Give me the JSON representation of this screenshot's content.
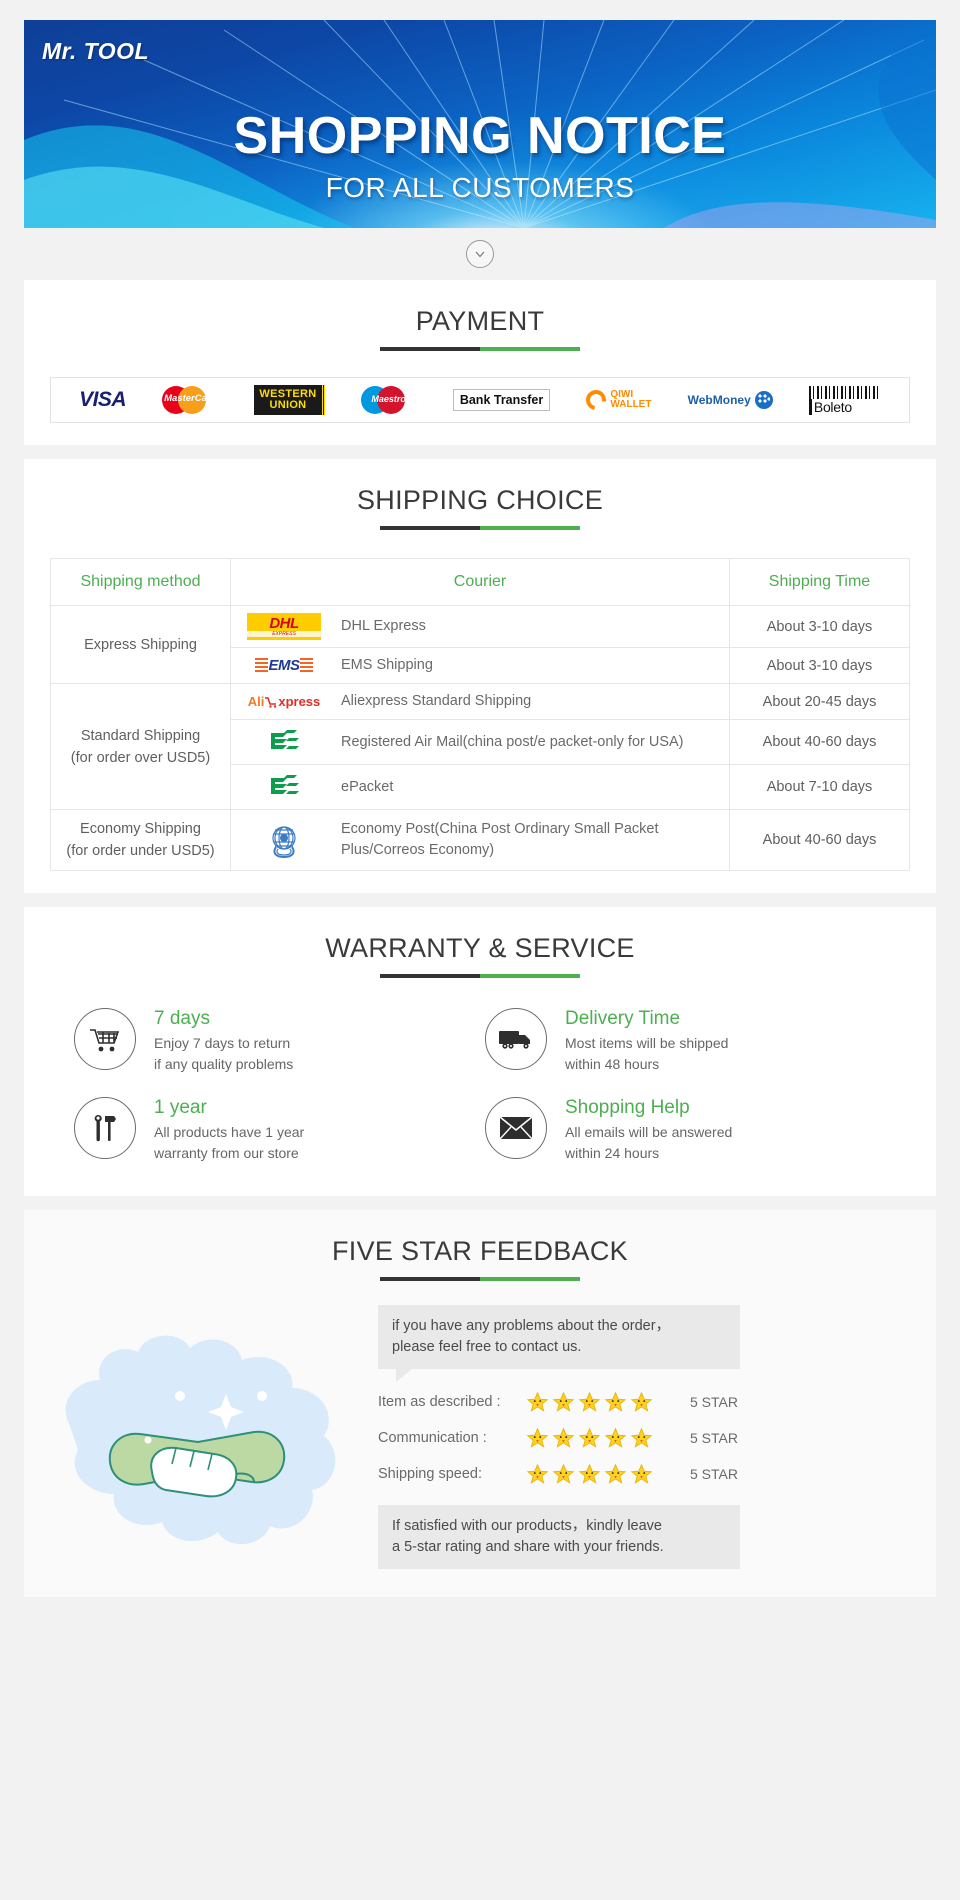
{
  "banner": {
    "logo": "Mr. TOOL",
    "title": "SHOPPING NOTICE",
    "subtitle": "FOR ALL CUSTOMERS",
    "scroll_icon": "chevron-down-icon"
  },
  "payment": {
    "heading": "PAYMENT",
    "methods": [
      {
        "name": "VISA",
        "icon": "visa-logo"
      },
      {
        "name": "MasterCard",
        "icon": "mastercard-logo"
      },
      {
        "name": "WESTERN UNION",
        "line1": "WESTERN",
        "line2": "UNION",
        "icon": "western-union-logo"
      },
      {
        "name": "Maestro",
        "icon": "maestro-logo"
      },
      {
        "name": "Bank Transfer",
        "icon": "bank-transfer-logo"
      },
      {
        "name": "QIWI WALLET",
        "line1": "QIWI",
        "line2": "WALLET",
        "icon": "qiwi-wallet-logo"
      },
      {
        "name": "WebMoney",
        "icon": "webmoney-logo"
      },
      {
        "name": "Boletо",
        "icon": "boleto-logo"
      }
    ]
  },
  "shipping": {
    "heading": "SHIPPING CHOICE",
    "columns": [
      "Shipping method",
      "Courier",
      "Shipping Time"
    ],
    "groups": [
      {
        "method": "Express Shipping",
        "rows": [
          {
            "logo": "dhl-logo",
            "courier": "DHL Express",
            "time": "About 3-10 days"
          },
          {
            "logo": "ems-logo",
            "courier": "EMS Shipping",
            "time": "About 3-10 days"
          }
        ]
      },
      {
        "method": "Standard Shipping\n(for order over USD5)",
        "method_line1": "Standard Shipping",
        "method_line2": "(for order over USD5)",
        "rows": [
          {
            "logo": "aliexpress-logo",
            "courier": "Aliexpress Standard Shipping",
            "time": "About 20-45 days"
          },
          {
            "logo": "china-post-logo",
            "courier": "Registered Air Mail(china post/e packet-only for USA)",
            "time": "About 40-60 days"
          },
          {
            "logo": "china-post-logo",
            "courier": "ePacket",
            "time": "About 7-10 days"
          }
        ]
      },
      {
        "method_line1": "Economy Shipping",
        "method_line2": "(for order under USD5)",
        "rows": [
          {
            "logo": "un-logo",
            "courier": "Economy Post(China Post Ordinary Small Packet Plus/Correos Economy)",
            "time": "About 40-60 days"
          }
        ]
      }
    ]
  },
  "warranty": {
    "heading": "WARRANTY & SERVICE",
    "features": [
      {
        "icon": "shopping-cart-icon",
        "title": "7 days",
        "line1": "Enjoy 7 days to return",
        "line2": "if any quality problems"
      },
      {
        "icon": "truck-icon",
        "title": "Delivery Time",
        "line1": "Most items will be shipped",
        "line2": "within 48 hours"
      },
      {
        "icon": "tools-icon",
        "title": "1 year",
        "line1": "All products have 1 year",
        "line2": "warranty from our store"
      },
      {
        "icon": "envelope-icon",
        "title": "Shopping Help",
        "line1": "All emails will be answered",
        "line2": "within 24 hours"
      }
    ]
  },
  "feedback": {
    "heading": "FIVE STAR FEEDBACK",
    "illustration": "handshake-illustration",
    "top_bubble_line1": "if you have any problems about the order，",
    "top_bubble_line2": "please feel free to contact us.",
    "ratings": [
      {
        "label": "Item as described :",
        "stars": 5,
        "value": "5 STAR"
      },
      {
        "label": "Communication :",
        "stars": 5,
        "value": "5 STAR"
      },
      {
        "label": "Shipping speed:",
        "stars": 5,
        "value": "5 STAR"
      }
    ],
    "bottom_bubble_line1": "If satisfied with our products，kindly leave",
    "bottom_bubble_line2": "a 5-star rating and share with your friends."
  },
  "colors": {
    "accent_green": "#4caf50",
    "rule_dark": "#333333",
    "banner_blue": "#0d47a6",
    "star_yellow": "#ffd21e"
  }
}
